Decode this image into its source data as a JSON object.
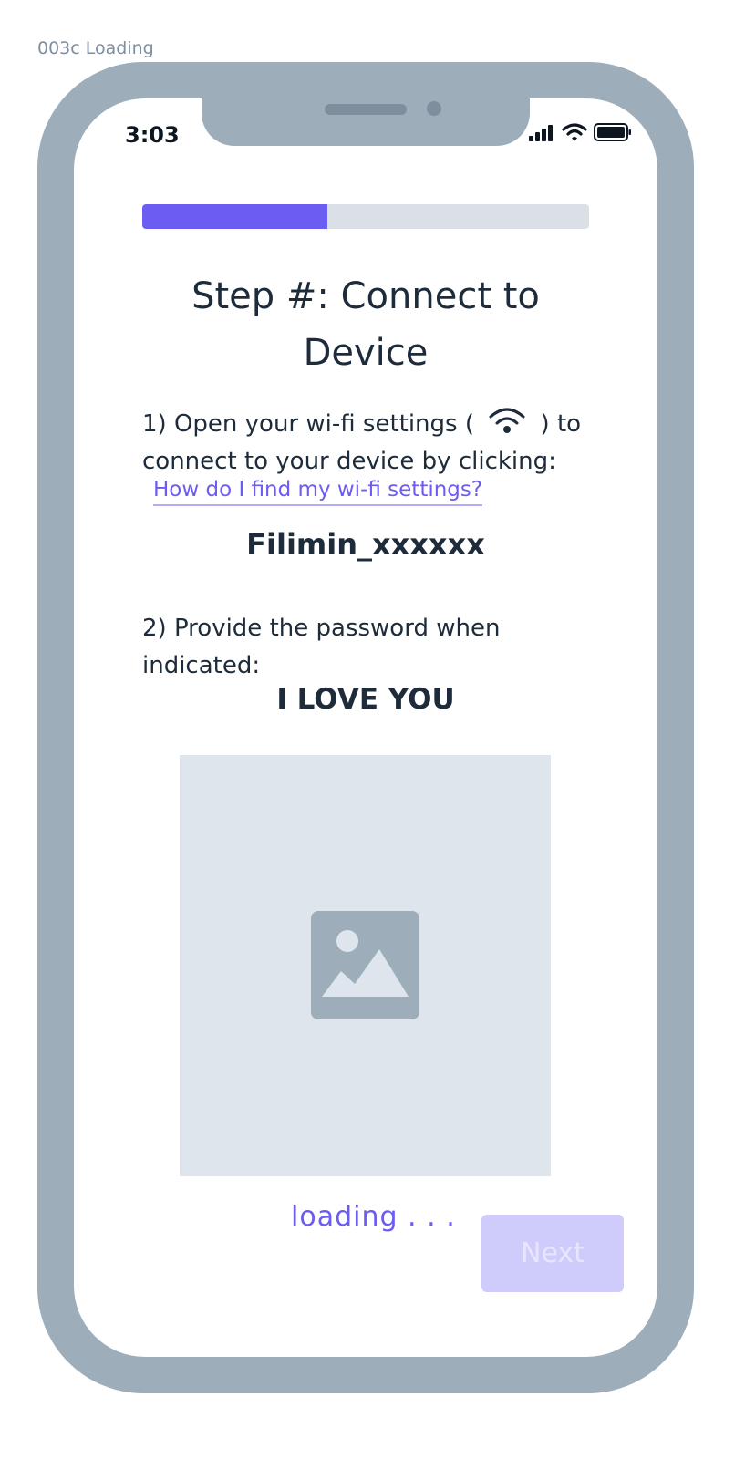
{
  "frame": {
    "label": "003c Loading"
  },
  "status_bar": {
    "time": "3:03",
    "icons": [
      "signal-icon",
      "wifi-icon",
      "battery-icon"
    ]
  },
  "progress": {
    "fraction": 0.415,
    "fill_color": "#6b5cf2",
    "track_color": "#dbdfe6"
  },
  "content": {
    "title": "Step #: Connect to Device",
    "step1_before_icon": "1) Open your wi-fi settings (",
    "step1_icon": "wifi-icon",
    "step1_after_icon": ") to connect to your device by clicking:",
    "help_link": "How do I find my wi-fi settings?",
    "network_name": "Filimin_xxxxxx",
    "step2": "2) Provide the password when indicated:",
    "password": "I LOVE YOU",
    "image_icon": "image-placeholder-icon"
  },
  "footer": {
    "loading": "loading . . .",
    "next_label": "Next"
  },
  "colors": {
    "accent": "#6b5cf2",
    "phone_frame": "#9dadba",
    "text": "#1e2b3a",
    "next_disabled_bg": "#cfcbfb"
  }
}
